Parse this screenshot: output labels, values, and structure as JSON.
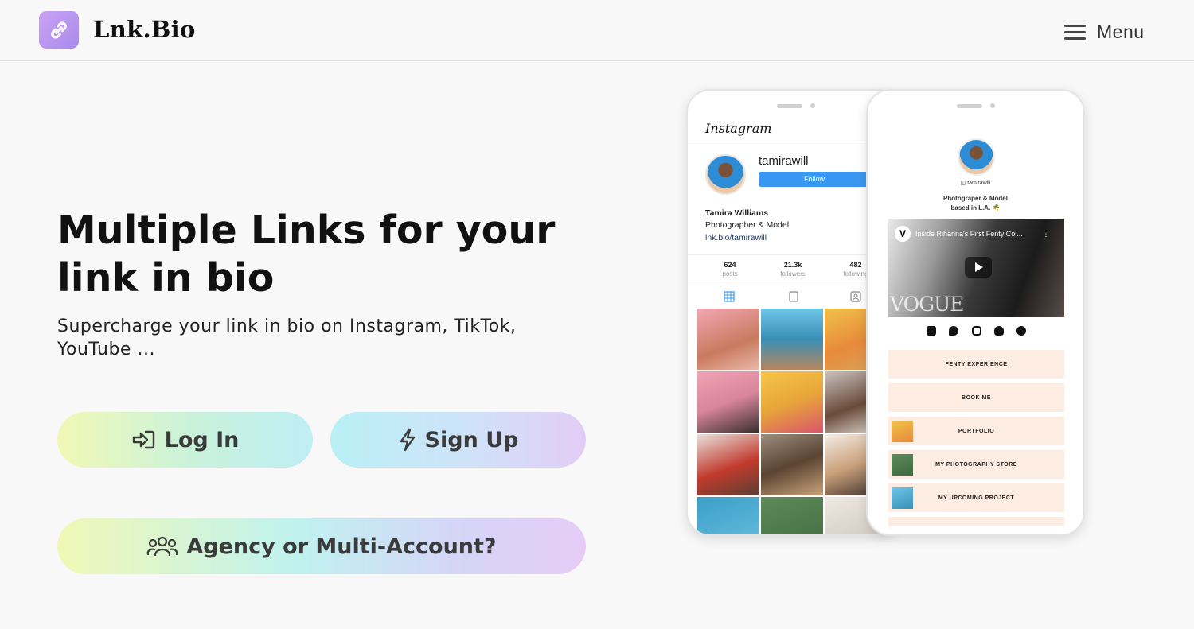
{
  "header": {
    "brand": "Lnk.Bio",
    "menu_label": "Menu"
  },
  "hero": {
    "title": "Multiple Links for your link in bio",
    "subtitle": "Supercharge your link in bio on Instagram, TikTok, YouTube ..."
  },
  "buttons": {
    "login": "Log In",
    "signup": "Sign Up",
    "agency": "Agency or Multi-Account?"
  },
  "instagram_mock": {
    "wordmark": "Instagram",
    "username": "tamirawill",
    "follow_label": "Follow",
    "name": "Tamira Williams",
    "bio": "Photographer & Model",
    "link": "lnk.bio/tamirawill",
    "stats": [
      {
        "value": "624",
        "label": "posts"
      },
      {
        "value": "21.3k",
        "label": "followers"
      },
      {
        "value": "482",
        "label": "following"
      }
    ]
  },
  "lnkbio_mock": {
    "handle": "tamirawill",
    "bio_line1": "Photograper & Model",
    "bio_line2": "based in L.A. 🌴",
    "video_title": "Inside Rihanna's First Fenty Col...",
    "video_watermark": "VOGUE",
    "social_icons": [
      "tiktok-icon",
      "twitter-icon",
      "instagram-icon",
      "snapchat-icon",
      "patreon-icon"
    ],
    "links": [
      "FENTY EXPERIENCE",
      "BOOK ME",
      "PORTFOLIO",
      "MY PHOTOGRAPHY STORE",
      "MY UPCOMING PROJECT"
    ]
  },
  "colors": {
    "logo_gradient": [
      "#c9a2f5",
      "#a98be9"
    ],
    "instagram_follow": "#3897f0",
    "link_button_bg": "#fdece1"
  }
}
